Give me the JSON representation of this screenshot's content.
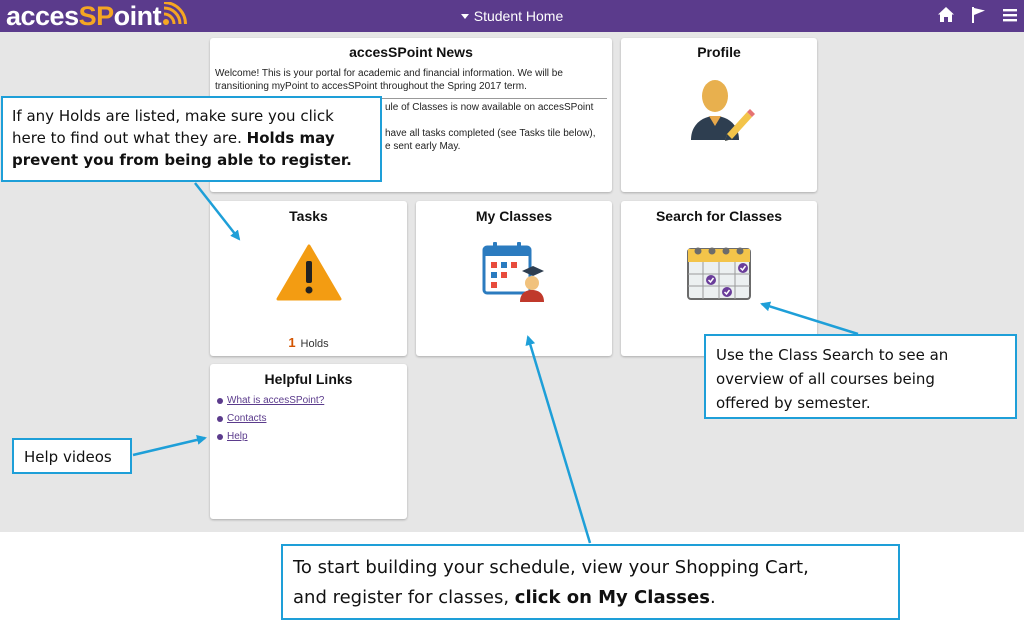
{
  "header": {
    "logo_prefix": "acces",
    "logo_caps": "SP",
    "logo_suffix": "oint",
    "title": "Student Home",
    "colors": {
      "bar": "#5b3b8c",
      "logo_accent": "#f5a623"
    },
    "icons": [
      "home-icon",
      "flag-icon",
      "menu-icon"
    ]
  },
  "tiles": {
    "news": {
      "title": "accesSPoint News",
      "line1": "Welcome! This is your portal for academic and financial information. We will be",
      "line2": "transitioning myPoint to accesSPoint throughout the Spring 2017 term.",
      "line3": "ule of Classes is now available on accesSPoint",
      "line4": "have all tasks completed (see Tasks tile below),",
      "line5": "e sent early May."
    },
    "profile": {
      "title": "Profile",
      "icon": "user-edit-icon"
    },
    "tasks": {
      "title": "Tasks",
      "icon": "warning-icon",
      "holds_count": "1",
      "holds_label": "Holds"
    },
    "my_classes": {
      "title": "My Classes",
      "icon": "calendar-student-icon"
    },
    "search_classes": {
      "title": "Search for Classes",
      "icon": "calendar-check-icon"
    },
    "helpful_links": {
      "title": "Helpful Links",
      "links": [
        "What is accesSPoint?",
        "Contacts",
        "Help"
      ]
    }
  },
  "callouts": {
    "holds": {
      "line1": "If any Holds are listed, make sure you click",
      "line2a": "here to find out what they are. ",
      "line2b": "Holds may",
      "line3": "prevent you from being able to register."
    },
    "help_videos": {
      "text": "Help videos"
    },
    "class_search": {
      "line1": "Use the Class Search to see an",
      "line2": "overview of all courses being",
      "line3": "offered by semester."
    },
    "my_classes": {
      "line1": "To start building your schedule, view your Shopping Cart,",
      "line2a": "and register for classes, ",
      "line2b": "click on My Classes",
      "line2c": "."
    },
    "color": "#1e9fd8"
  }
}
